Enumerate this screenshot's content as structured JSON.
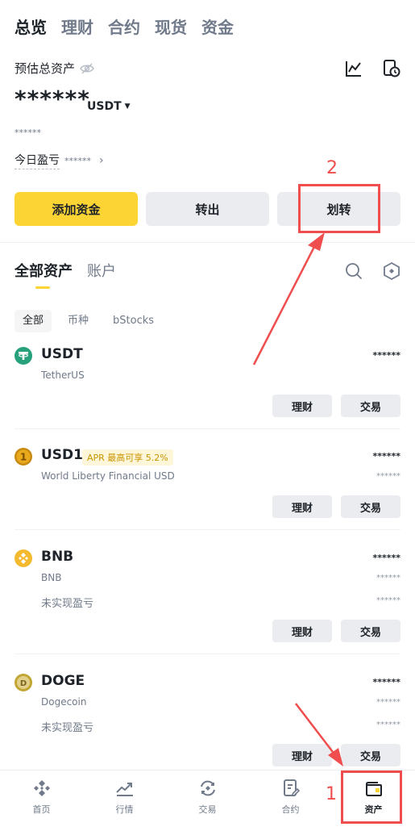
{
  "top_tabs": [
    "总览",
    "理财",
    "合约",
    "现货",
    "资金"
  ],
  "overview": {
    "est_label": "预估总资产",
    "balance": "******",
    "currency": "USDT",
    "sub_balance": "******",
    "pnl_label": "今日盈亏",
    "pnl_value": "******"
  },
  "actions": {
    "deposit": "添加资金",
    "withdraw": "转出",
    "transfer": "划转"
  },
  "asset_tabs": [
    "全部资产",
    "账户"
  ],
  "filters": [
    "全部",
    "币种",
    "bStocks"
  ],
  "assets": [
    {
      "symbol": "USDT",
      "name": "TetherUS",
      "amount": "******",
      "buttons": [
        "理财",
        "交易"
      ]
    },
    {
      "symbol": "USD1",
      "badge": "APR 最高可享 5.2%",
      "name": "World Liberty Financial USD",
      "amount": "******",
      "amount2": "******",
      "buttons": [
        "理财",
        "交易"
      ]
    },
    {
      "symbol": "BNB",
      "name": "BNB",
      "unrealized_label": "未实现盈亏",
      "amount": "******",
      "amount2": "******",
      "amount3": "******",
      "buttons": [
        "理财",
        "交易"
      ]
    },
    {
      "symbol": "DOGE",
      "name": "Dogecoin",
      "unrealized_label": "未实现盈亏",
      "amount": "******",
      "amount2": "******",
      "amount3": "******",
      "buttons": [
        "理财",
        "交易"
      ]
    }
  ],
  "bottom_nav": [
    "首页",
    "行情",
    "交易",
    "合约",
    "资产"
  ],
  "annotations": [
    "1",
    "2"
  ],
  "colors": {
    "brand_yellow": "#fcd535",
    "annotation_red": "#f04e4e",
    "text_primary": "#1e2329",
    "text_secondary": "#707a8a"
  }
}
